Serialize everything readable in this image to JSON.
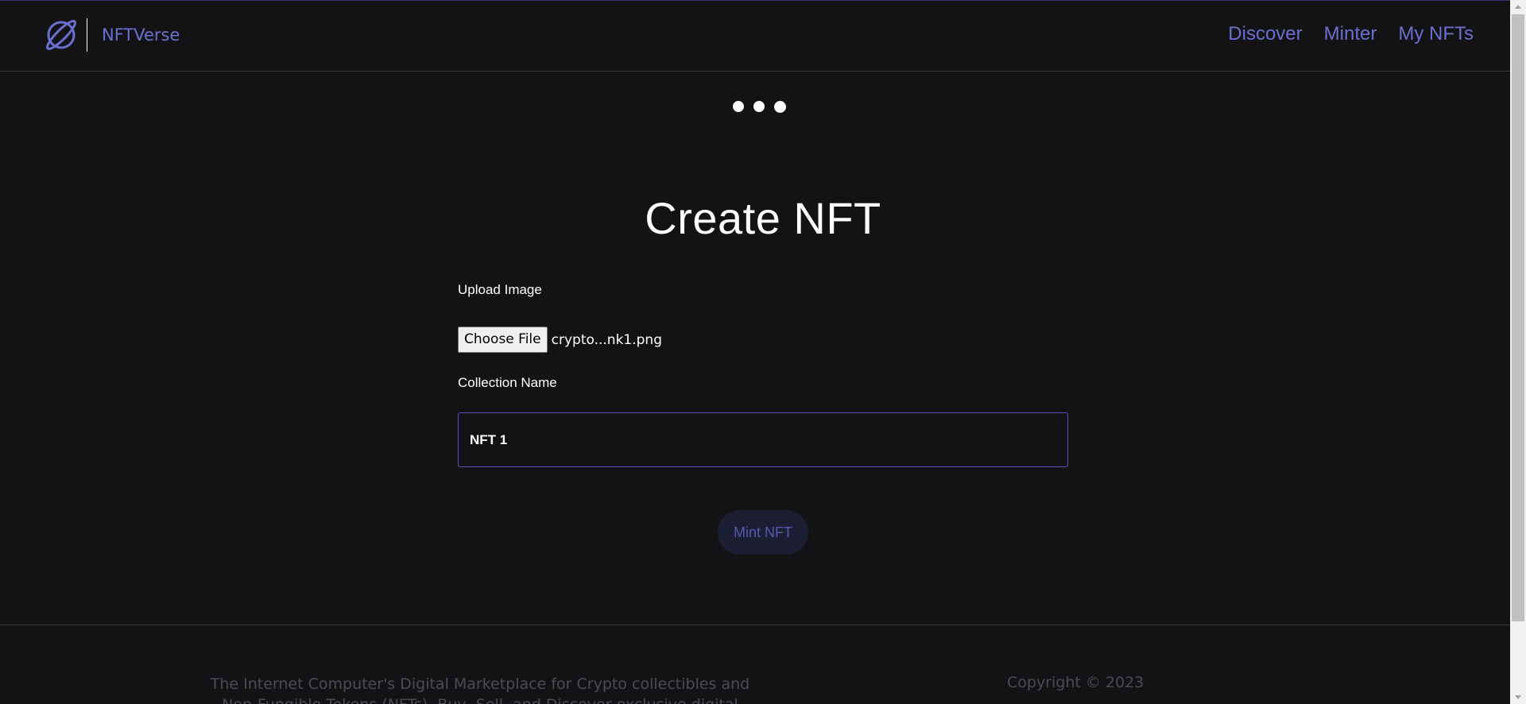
{
  "header": {
    "brand_name": "NFTVerse",
    "logo_icon": "planet-icon",
    "nav": [
      {
        "label": "Discover"
      },
      {
        "label": "Minter"
      },
      {
        "label": "My NFTs"
      }
    ],
    "accent_color": "#6b6fd0"
  },
  "loader": {
    "icon": "loading-dots-icon"
  },
  "main": {
    "title": "Create NFT",
    "upload": {
      "label": "Upload Image",
      "button_label": "Choose File",
      "file_name": "crypto...nk1.png"
    },
    "collection": {
      "label": "Collection Name",
      "value": "NFT 1"
    },
    "mint_button": "Mint NFT"
  },
  "footer": {
    "description": "The Internet Computer's Digital Marketplace for Crypto collectibles and Non-Fungible Tokens (NFTs). Buy, Sell, and Discover exclusive digital items.",
    "copyright": "Copyright © 2023"
  }
}
